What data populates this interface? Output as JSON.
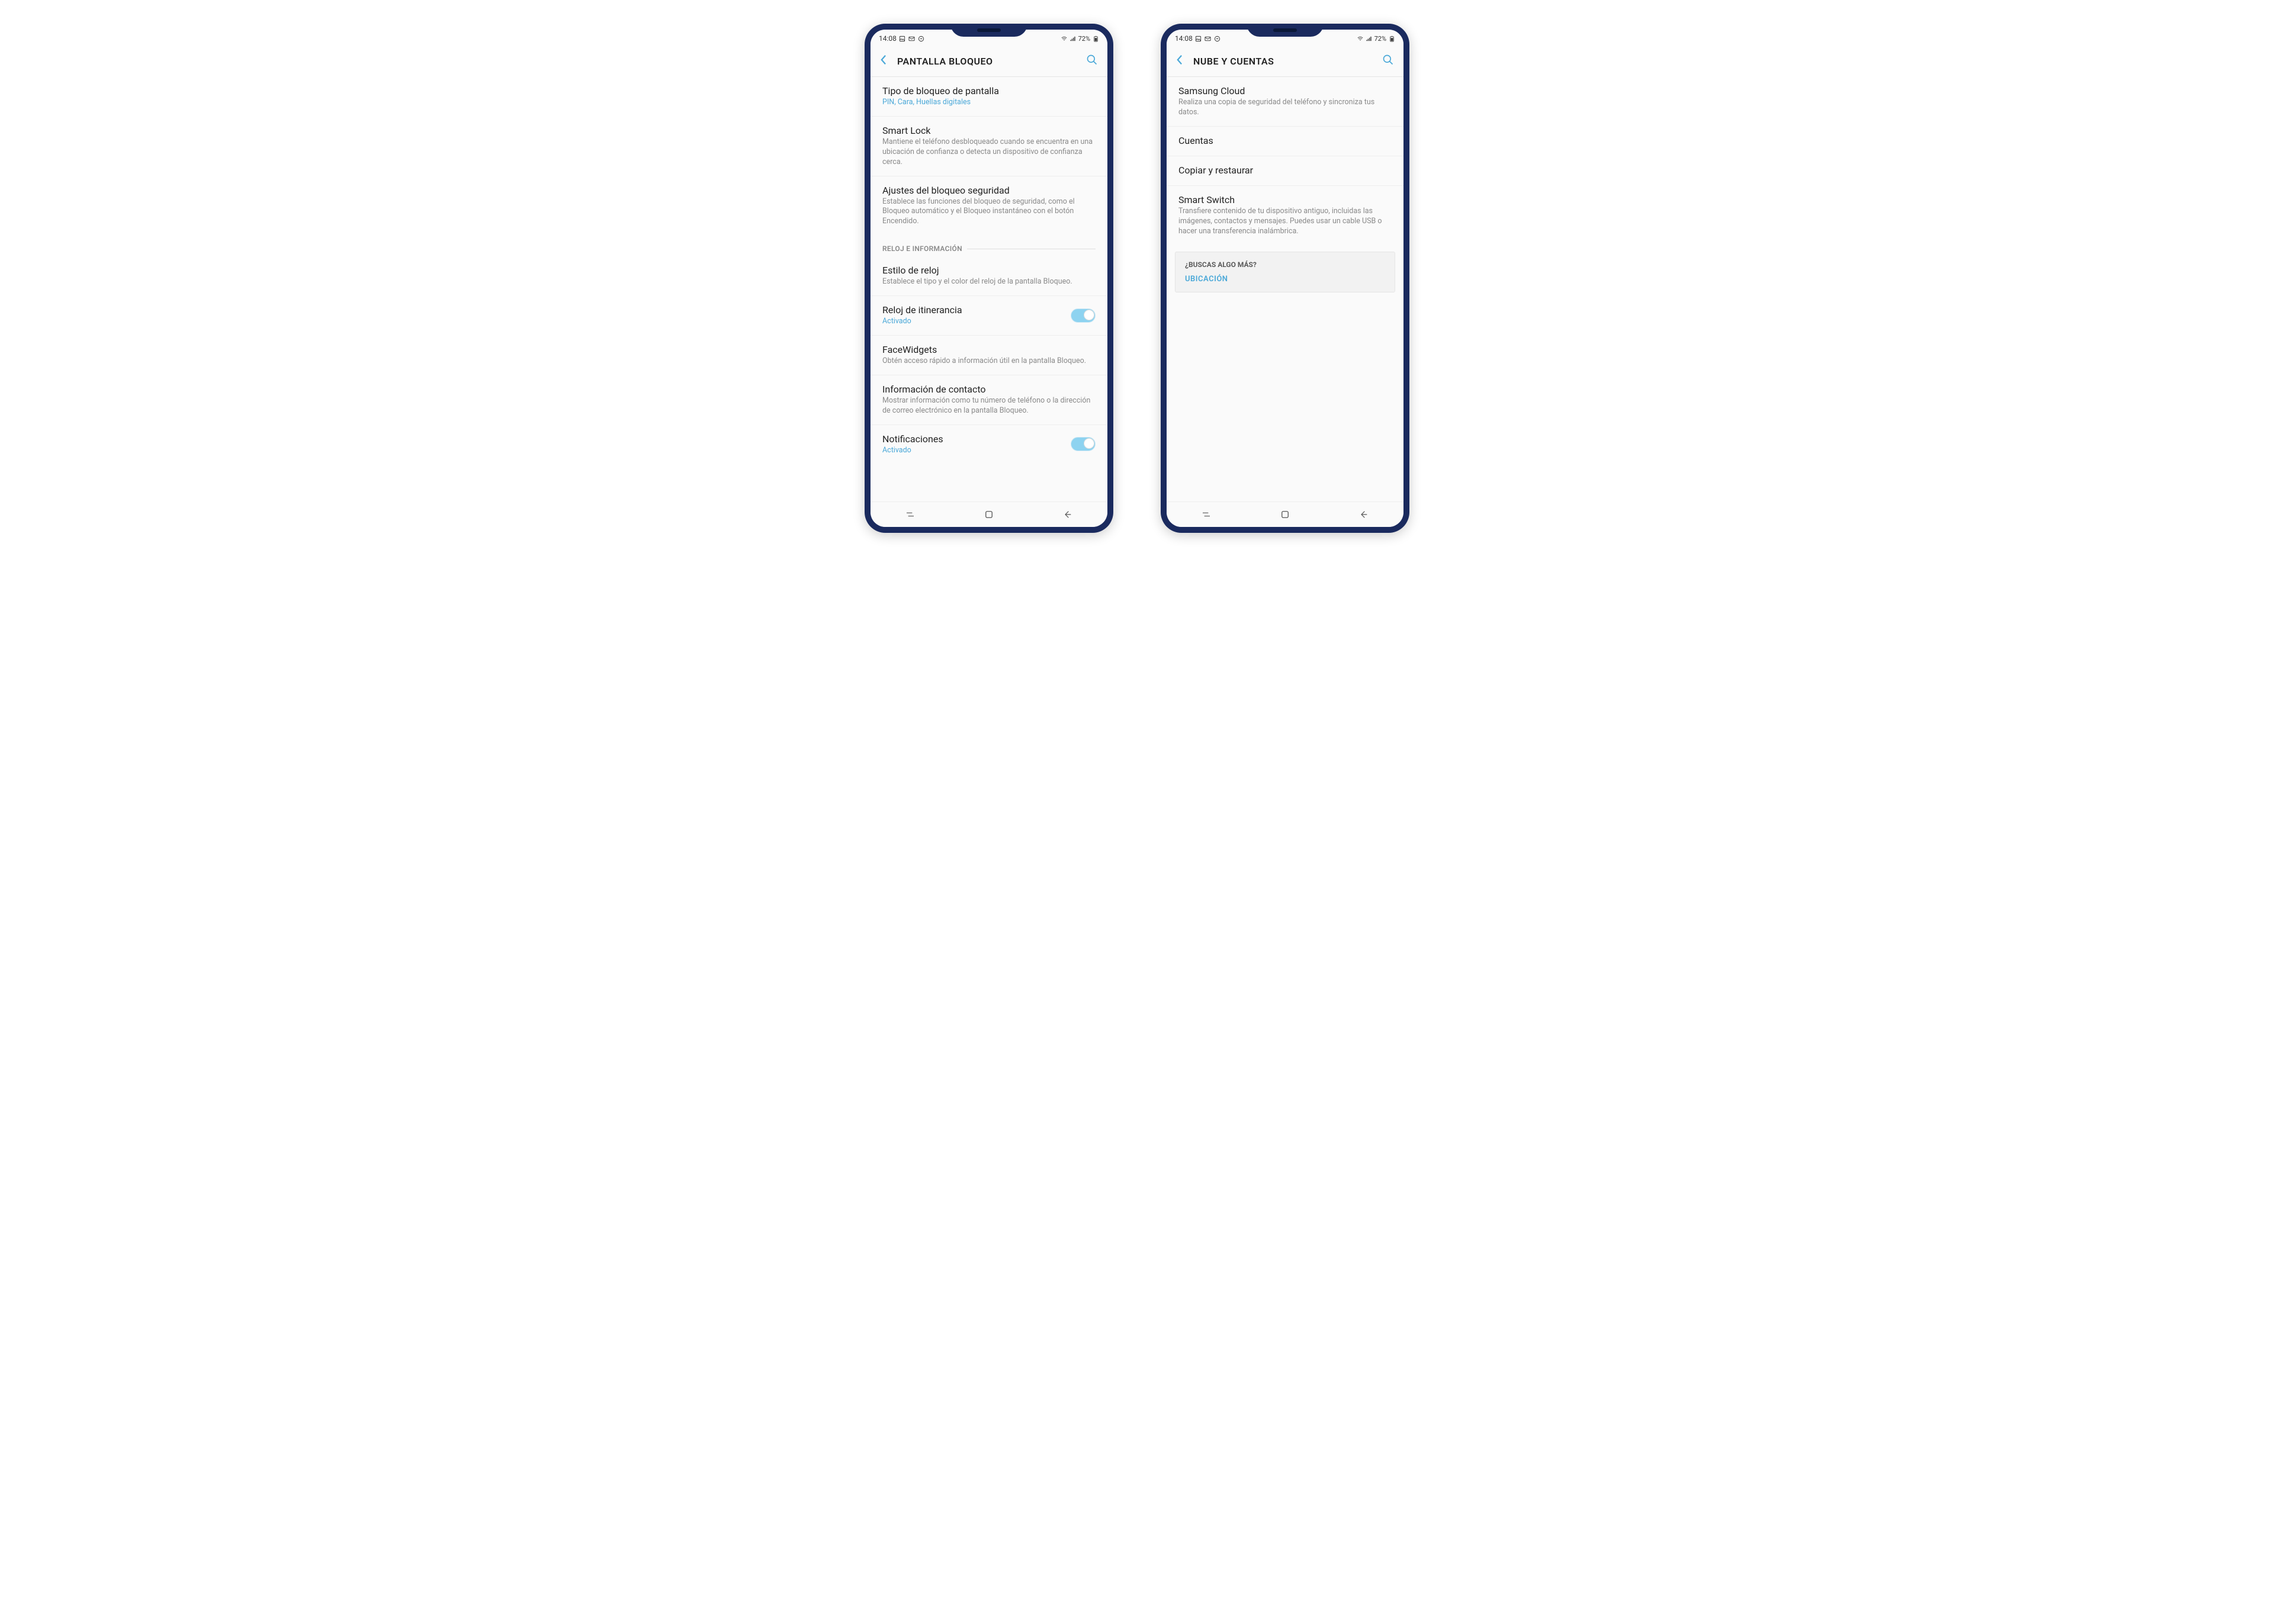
{
  "status": {
    "time": "14:08",
    "battery": "72%"
  },
  "left": {
    "title": "PANTALLA BLOQUEO",
    "items": {
      "lockType": {
        "title": "Tipo de bloqueo de pantalla",
        "sub": "PIN, Cara, Huellas digitales"
      },
      "smartLock": {
        "title": "Smart Lock",
        "sub": "Mantiene el teléfono desbloqueado cuando se encuentra en una ubicación de confianza o detecta un dispositivo de confianza cerca."
      },
      "secureLock": {
        "title": "Ajustes del bloqueo seguridad",
        "sub": "Establece las funciones del bloqueo de seguridad, como el Bloqueo automático y el Bloqueo instantáneo con el botón Encendido."
      },
      "section1": "RELOJ E INFORMACIÓN",
      "clockStyle": {
        "title": "Estilo de reloj",
        "sub": "Establece el tipo y el color del reloj de la pantalla Bloqueo."
      },
      "roaming": {
        "title": "Reloj de itinerancia",
        "sub": "Activado"
      },
      "faceWidgets": {
        "title": "FaceWidgets",
        "sub": "Obtén acceso rápido a información útil en la pantalla Bloqueo."
      },
      "contactInfo": {
        "title": "Información de contacto",
        "sub": "Mostrar información como tu número de teléfono o la dirección de correo electrónico en la pantalla Bloqueo."
      },
      "notifications": {
        "title": "Notificaciones",
        "sub": "Activado"
      }
    }
  },
  "right": {
    "title": "NUBE Y CUENTAS",
    "items": {
      "cloud": {
        "title": "Samsung Cloud",
        "sub": "Realiza una copia de seguridad del teléfono y sincroniza tus datos."
      },
      "accounts": {
        "title": "Cuentas"
      },
      "backup": {
        "title": "Copiar y restaurar"
      },
      "smartSwitch": {
        "title": "Smart Switch",
        "sub": "Transfiere contenido de tu dispositivo antiguo, incluidas las imágenes, contactos y mensajes. Puedes usar un cable USB o hacer una transferencia inalámbrica."
      }
    },
    "more": {
      "q": "¿BUSCAS ALGO MÁS?",
      "link": "UBICACIÓN"
    }
  }
}
